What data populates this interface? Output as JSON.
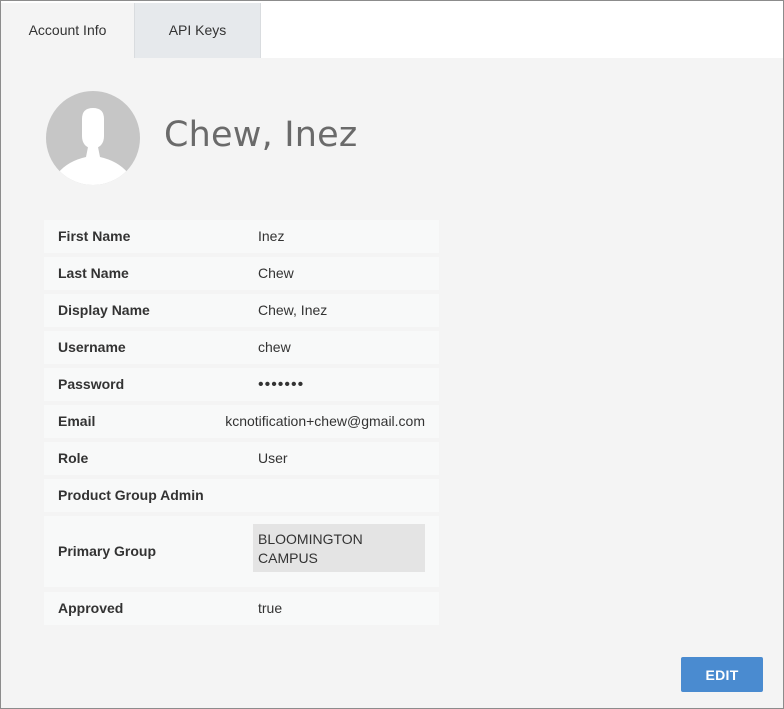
{
  "tabs": {
    "account_info": "Account Info",
    "api_keys": "API Keys"
  },
  "profile": {
    "display_name": "Chew, Inez",
    "avatar_icon": "default-user-silhouette-icon"
  },
  "fields": {
    "first_name": {
      "label": "First Name",
      "value": "Inez"
    },
    "last_name": {
      "label": "Last Name",
      "value": "Chew"
    },
    "display_name": {
      "label": "Display Name",
      "value": "Chew, Inez"
    },
    "username": {
      "label": "Username",
      "value": "chew"
    },
    "password": {
      "label": "Password",
      "value": "•••••••"
    },
    "email": {
      "label": "Email",
      "value": "kcnotification+chew@gmail.com"
    },
    "role": {
      "label": "Role",
      "value": "User"
    },
    "product_group_admin": {
      "label": "Product Group Admin",
      "value": ""
    },
    "primary_group": {
      "label": "Primary Group",
      "value": "BLOOMINGTON CAMPUS"
    },
    "approved": {
      "label": "Approved",
      "value": "true"
    }
  },
  "actions": {
    "edit_label": "EDIT"
  },
  "colors": {
    "accent_button": "#4a8bd0",
    "panel_background": "#f4f4f4",
    "row_background": "#f8f9f9"
  }
}
